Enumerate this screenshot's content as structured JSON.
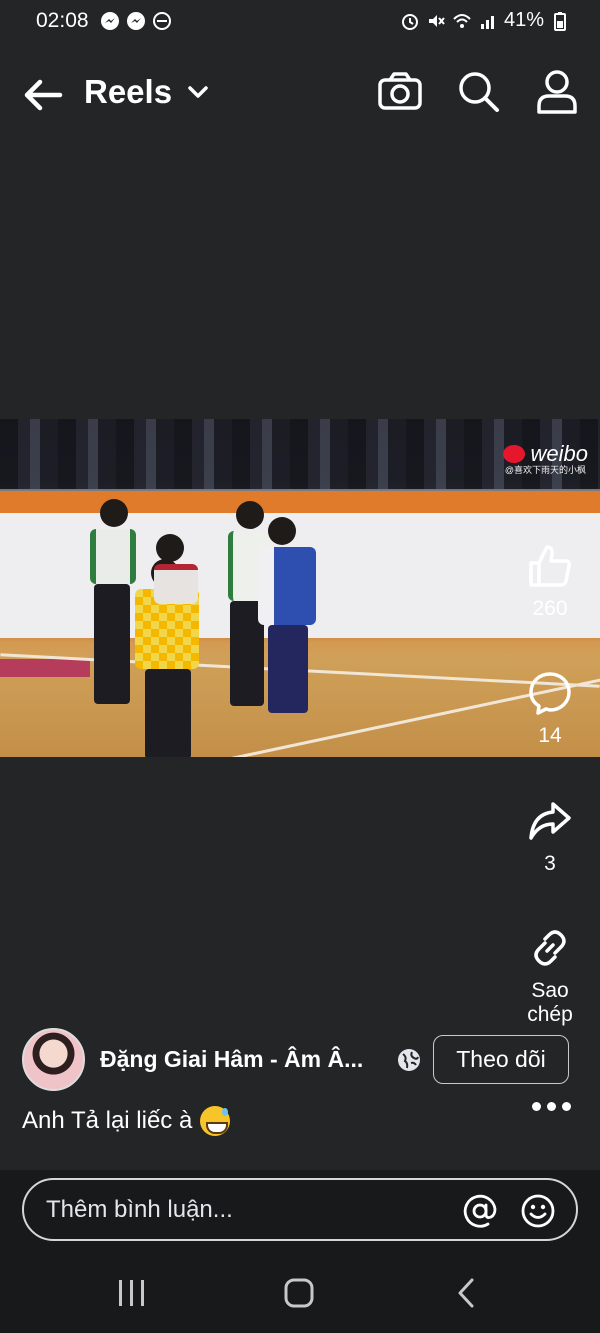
{
  "status_bar": {
    "time": "02:08",
    "battery": "41%"
  },
  "header": {
    "title": "Reels"
  },
  "actions": {
    "likes": "260",
    "comments": "14",
    "shares": "3",
    "copy_label": "Sao chép"
  },
  "video": {
    "watermark": "weibo",
    "watermark_sub": "@喜欢下雨天的小枫"
  },
  "author": {
    "name": "Đặng Giai Hâm - Âm Â...",
    "follow_label": "Theo dõi"
  },
  "caption": {
    "text": "Anh Tả lại liếc à"
  },
  "comment": {
    "placeholder": "Thêm bình luận..."
  },
  "colors": {
    "background": "#242526",
    "bottom_bar": "#18191a"
  }
}
